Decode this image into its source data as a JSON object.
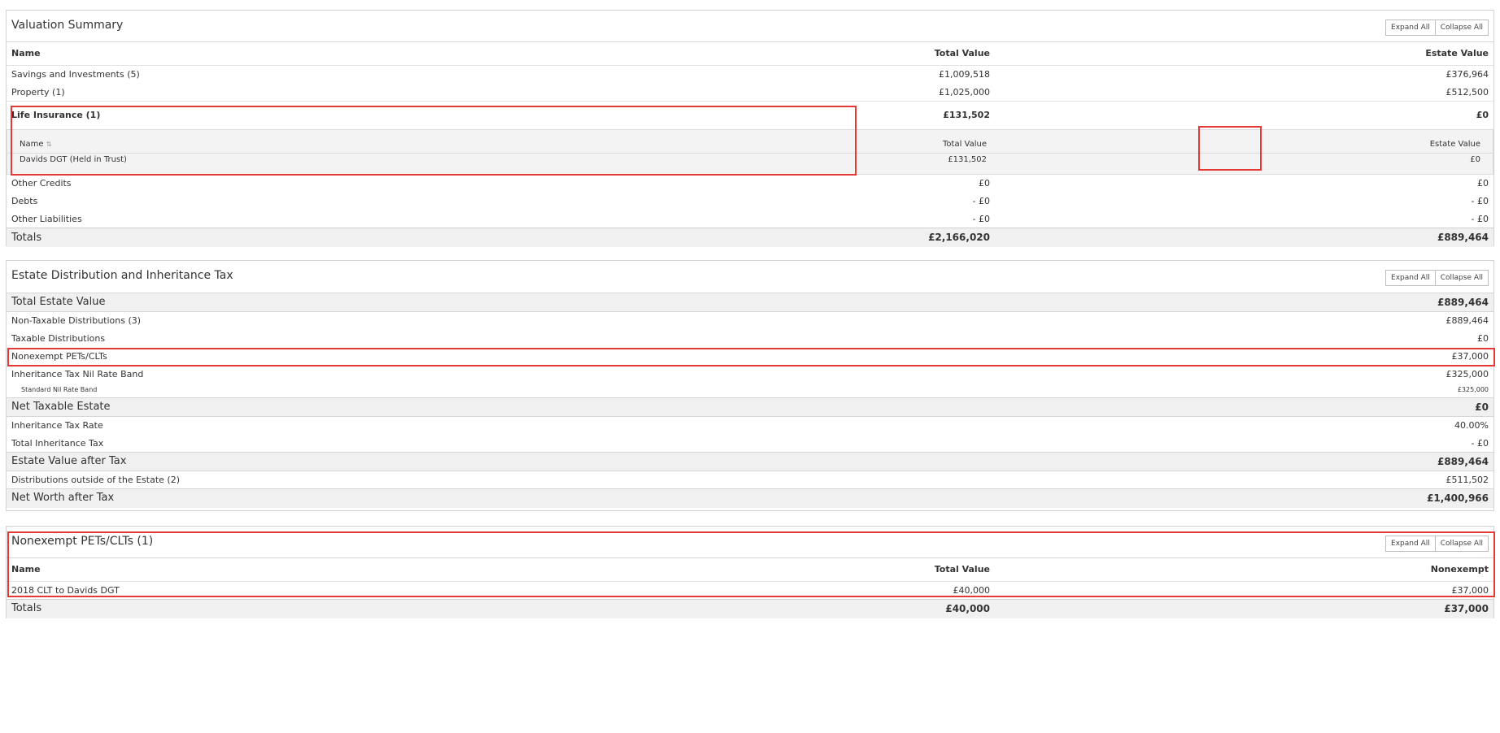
{
  "buttons": {
    "expand_all": "Expand All",
    "collapse_all": "Collapse All"
  },
  "valuation": {
    "title": "Valuation Summary",
    "headers": {
      "name": "Name",
      "total": "Total Value",
      "estate": "Estate Value"
    },
    "rows": [
      {
        "name": "Savings and Investments (5)",
        "total": "£1,009,518",
        "estate": "£376,964"
      },
      {
        "name": "Property (1)",
        "total": "£1,025,000",
        "estate": "£512,500"
      }
    ],
    "life": {
      "name": "Life Insurance (1)",
      "total": "£131,502",
      "estate": "£0",
      "sub_headers": {
        "name": "Name",
        "sort": "⇅",
        "total": "Total Value",
        "estate": "Estate Value"
      },
      "sub_row": {
        "name": "Davids DGT (Held in Trust)",
        "total": "£131,502",
        "estate": "£0"
      }
    },
    "rows2": [
      {
        "name": "Other Credits",
        "total": "£0",
        "estate": "£0"
      },
      {
        "name": "Debts",
        "total": "- £0",
        "estate": "- £0"
      },
      {
        "name": "Other Liabilities",
        "total": "- £0",
        "estate": "- £0"
      }
    ],
    "totals": {
      "label": "Totals",
      "total": "£2,166,020",
      "estate": "£889,464"
    }
  },
  "estate": {
    "title": "Estate Distribution and Inheritance Tax",
    "rows": [
      {
        "name": "Total Estate Value",
        "value": "£889,464"
      },
      {
        "name": "Non-Taxable Distributions (3)",
        "value": "£889,464"
      },
      {
        "name": "Taxable Distributions",
        "value": "£0"
      },
      {
        "name": "Nonexempt PETs/CLTs",
        "value": "£37,000"
      },
      {
        "name": "Inheritance Tax Nil Rate Band",
        "value": "£325,000"
      },
      {
        "name": "Standard Nil Rate Band",
        "value": "£325,000"
      },
      {
        "name": "Net Taxable Estate",
        "value": "£0"
      },
      {
        "name": "Inheritance Tax Rate",
        "value": "40.00%"
      },
      {
        "name": "Total Inheritance Tax",
        "value": "- £0"
      },
      {
        "name": "Estate Value after Tax",
        "value": "£889,464"
      },
      {
        "name": "Distributions outside of the Estate (2)",
        "value": "£511,502"
      },
      {
        "name": "Net Worth after Tax",
        "value": "£1,400,966"
      }
    ]
  },
  "pets": {
    "title": "Nonexempt PETs/CLTs (1)",
    "headers": {
      "name": "Name",
      "total": "Total Value",
      "nonexempt": "Nonexempt"
    },
    "row": {
      "name": "2018 CLT to Davids DGT",
      "total": "£40,000",
      "nonexempt": "£37,000"
    },
    "totals": {
      "label": "Totals",
      "total": "£40,000",
      "nonexempt": "£37,000"
    }
  },
  "colors": {
    "highlight": "#e53935",
    "row_grey": "#f0f0f0",
    "border": "#d2d2d2"
  }
}
